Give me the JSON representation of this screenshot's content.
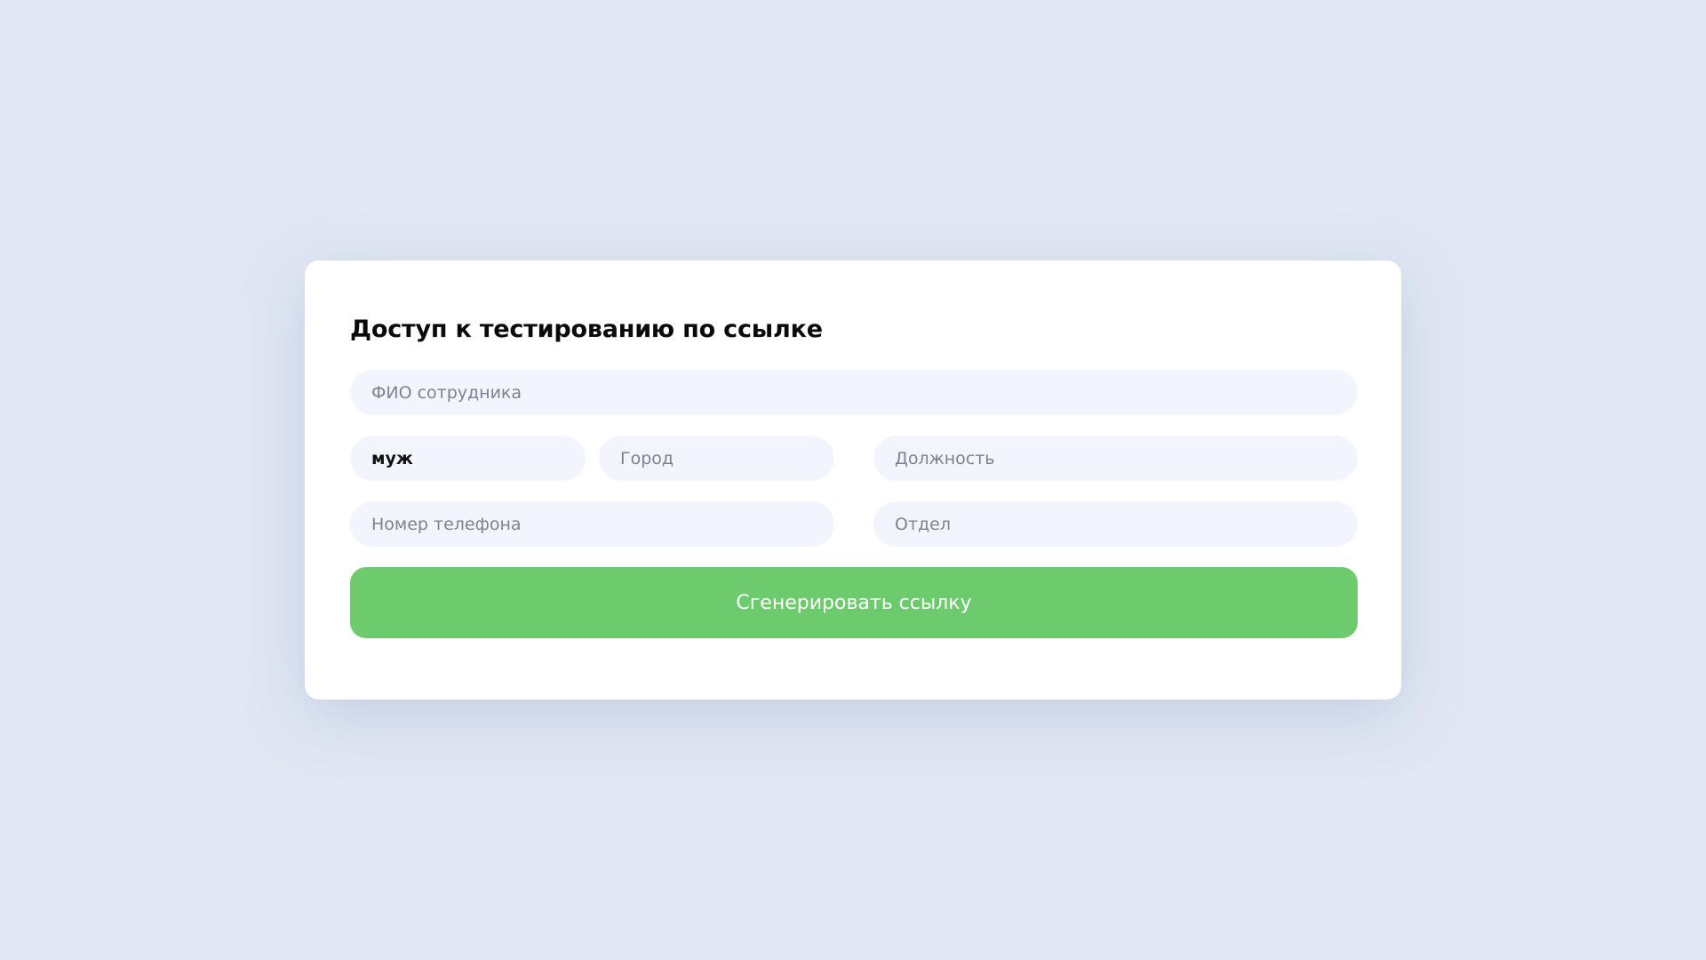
{
  "form": {
    "title": "Доступ к тестированию по ссылке",
    "fields": {
      "full_name": {
        "value": "",
        "placeholder": "ФИО сотрудника"
      },
      "gender": {
        "value": "муж",
        "placeholder": ""
      },
      "city": {
        "value": "",
        "placeholder": "Город"
      },
      "position": {
        "value": "",
        "placeholder": "Должность"
      },
      "phone": {
        "value": "",
        "placeholder": "Номер телефона"
      },
      "department": {
        "value": "",
        "placeholder": "Отдел"
      }
    },
    "submit_label": "Сгенерировать ссылку"
  },
  "colors": {
    "background": "#e1e8f4",
    "card": "#ffffff",
    "field_bg": "#f2f6fc",
    "accent": "#6dca6d"
  }
}
